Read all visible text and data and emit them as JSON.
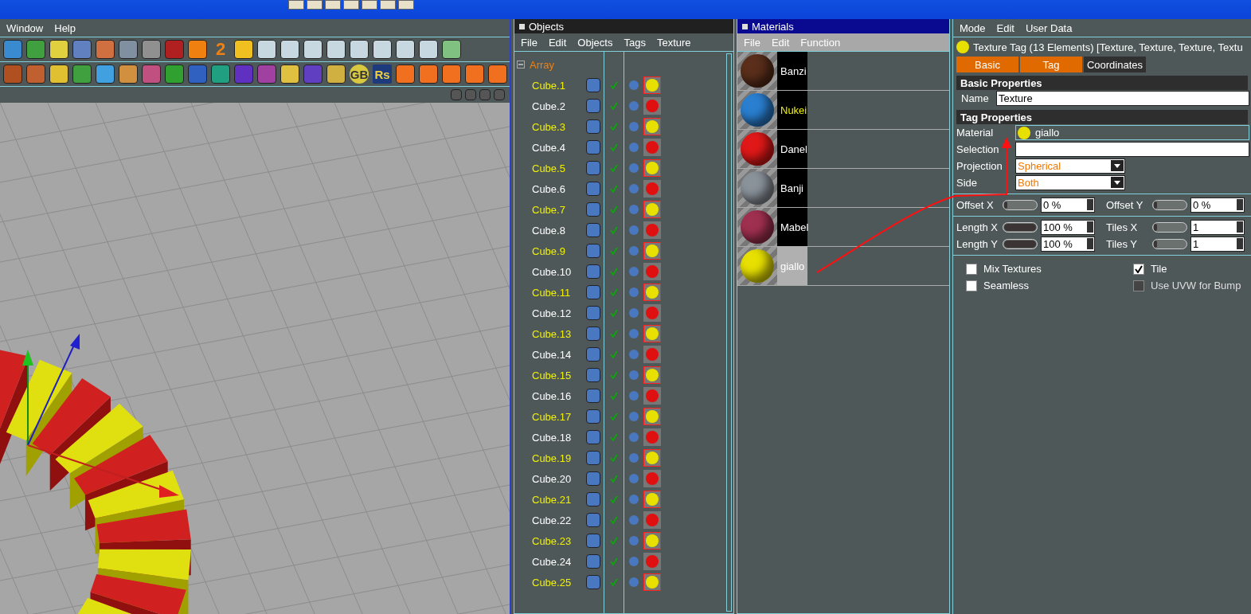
{
  "main_menu": [
    "Window",
    "Help"
  ],
  "toolbar": {
    "labels": [
      {
        "kind": "version",
        "text": "2"
      },
      {
        "kind": "logo-round",
        "text": "GB"
      },
      {
        "kind": "logo-square",
        "text": "Rs"
      }
    ]
  },
  "objects": {
    "title": "Objects",
    "menu": [
      "File",
      "Edit",
      "Objects",
      "Tags",
      "Texture"
    ],
    "root": {
      "name": "Array",
      "expanded": true,
      "children": [
        {
          "name": "Cube.1",
          "selected": true,
          "color": "#e8e000"
        },
        {
          "name": "Cube.2",
          "selected": false,
          "color": "#e01010"
        },
        {
          "name": "Cube.3",
          "selected": true,
          "color": "#e8e000"
        },
        {
          "name": "Cube.4",
          "selected": false,
          "color": "#e01010"
        },
        {
          "name": "Cube.5",
          "selected": true,
          "color": "#e8e000"
        },
        {
          "name": "Cube.6",
          "selected": false,
          "color": "#e01010"
        },
        {
          "name": "Cube.7",
          "selected": true,
          "color": "#e8e000"
        },
        {
          "name": "Cube.8",
          "selected": false,
          "color": "#e01010"
        },
        {
          "name": "Cube.9",
          "selected": true,
          "color": "#e8e000"
        },
        {
          "name": "Cube.10",
          "selected": false,
          "color": "#e01010"
        },
        {
          "name": "Cube.11",
          "selected": true,
          "color": "#e8e000"
        },
        {
          "name": "Cube.12",
          "selected": false,
          "color": "#e01010"
        },
        {
          "name": "Cube.13",
          "selected": true,
          "color": "#e8e000"
        },
        {
          "name": "Cube.14",
          "selected": false,
          "color": "#e01010"
        },
        {
          "name": "Cube.15",
          "selected": true,
          "color": "#e8e000"
        },
        {
          "name": "Cube.16",
          "selected": false,
          "color": "#e01010"
        },
        {
          "name": "Cube.17",
          "selected": true,
          "color": "#e8e000"
        },
        {
          "name": "Cube.18",
          "selected": false,
          "color": "#e01010"
        },
        {
          "name": "Cube.19",
          "selected": true,
          "color": "#e8e000"
        },
        {
          "name": "Cube.20",
          "selected": false,
          "color": "#e01010"
        },
        {
          "name": "Cube.21",
          "selected": true,
          "color": "#e8e000"
        },
        {
          "name": "Cube.22",
          "selected": false,
          "color": "#e01010"
        },
        {
          "name": "Cube.23",
          "selected": true,
          "color": "#e8e000"
        },
        {
          "name": "Cube.24",
          "selected": false,
          "color": "#e01010"
        },
        {
          "name": "Cube.25",
          "selected": true,
          "color": "#e8e000"
        }
      ]
    }
  },
  "materials": {
    "title": "Materials",
    "menu": [
      "File",
      "Edit",
      "Function"
    ],
    "items": [
      {
        "name": "Banzi",
        "selected": false,
        "active": false,
        "color": "#5a2e1a"
      },
      {
        "name": "Nukei",
        "selected": false,
        "active": true,
        "color": "#2a7fd0"
      },
      {
        "name": "Danel",
        "selected": false,
        "active": false,
        "color": "#e01818"
      },
      {
        "name": "Banji",
        "selected": false,
        "active": false,
        "color": "#8a929a"
      },
      {
        "name": "Mabel",
        "selected": false,
        "active": false,
        "color": "#a03050"
      },
      {
        "name": "giallo",
        "selected": true,
        "active": false,
        "color": "#e8e000"
      }
    ]
  },
  "attributes": {
    "menu": [
      "Mode",
      "Edit",
      "User Data"
    ],
    "title": "Texture Tag (13 Elements) [Texture, Texture, Texture, Textu",
    "tabs": [
      {
        "label": "Basic",
        "selected": true
      },
      {
        "label": "Tag",
        "selected": true
      },
      {
        "label": "Coordinates",
        "selected": false
      }
    ],
    "basic_heading": "Basic Properties",
    "name_field": {
      "label": "Name",
      "value": "Texture"
    },
    "tag_heading": "Tag Properties",
    "material_field": {
      "label": "Material",
      "value": "giallo"
    },
    "selection_field": {
      "label": "Selection"
    },
    "dropdowns": [
      {
        "label": "Projection",
        "value": "Spherical"
      },
      {
        "label": "Side",
        "value": "Both"
      }
    ],
    "slider_rows": [
      [
        {
          "label": "Offset X",
          "level": 0,
          "value": "0 %"
        },
        {
          "label": "Offset Y",
          "level": 0,
          "value": "0 %"
        }
      ],
      [
        {
          "label": "Length X",
          "level": 1,
          "value": "100 %"
        },
        {
          "label": "Tiles X",
          "level": 0,
          "value": "1"
        }
      ],
      [
        {
          "label": "Length Y",
          "level": 1,
          "value": "100 %"
        },
        {
          "label": "Tiles Y",
          "level": 0,
          "value": "1"
        }
      ]
    ],
    "checkboxes": [
      {
        "label": "Mix Textures",
        "checked": false,
        "disabled": false
      },
      {
        "label": "Tile",
        "checked": true,
        "disabled": false
      },
      {
        "label": "Seamless",
        "checked": false,
        "disabled": false
      },
      {
        "label": "Use UVW for Bump",
        "checked": false,
        "disabled": true
      }
    ]
  }
}
